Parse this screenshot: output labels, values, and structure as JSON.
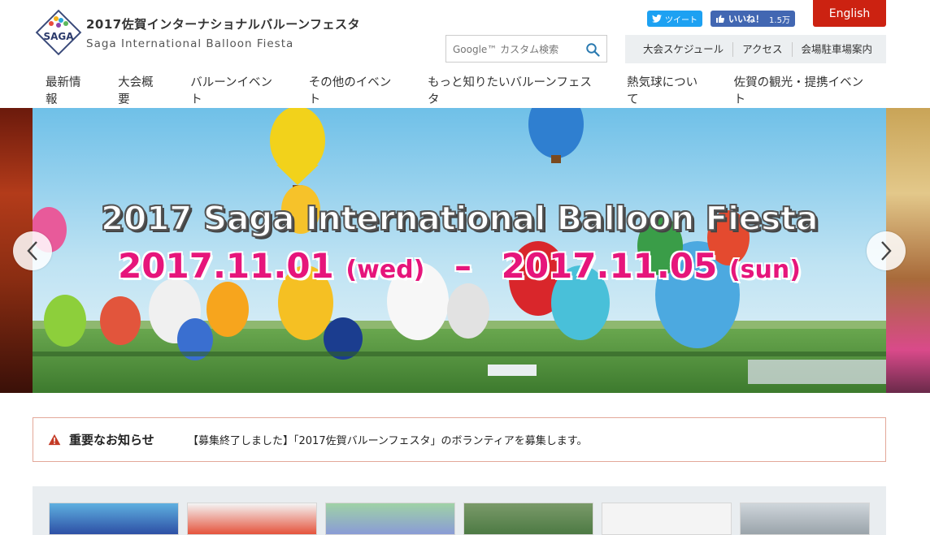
{
  "site": {
    "title": "2017佐賀インターナショナルバルーンフェスタ",
    "subtitle": "Saga International Balloon Fiesta",
    "logo_text": "SAGA"
  },
  "social": {
    "tweet_label": "ツイート",
    "like_label": "いいね！",
    "like_count": "1.5万"
  },
  "language_button": "English",
  "search": {
    "placeholder": "Google™ カスタム検索",
    "icon": "search-icon"
  },
  "quick_links": [
    "大会スケジュール",
    "アクセス",
    "会場駐車場案内"
  ],
  "nav": [
    "最新情報",
    "大会概要",
    "バルーンイベント",
    "その他のイベント",
    "もっと知りたいバルーンフェスタ",
    "熱気球について",
    "佐賀の観光・提携イベント"
  ],
  "hero": {
    "title": "2017 Saga International Balloon Fiesta",
    "start_date": "2017.11.01",
    "start_day": "(wed)",
    "separator": "–",
    "end_date": "2017.11.05",
    "end_day": "(sun)",
    "prev_icon": "chevron-left-icon",
    "next_icon": "chevron-right-icon"
  },
  "notice": {
    "heading": "重要なお知らせ",
    "text": "【募集終了しました】「2017佐賀バルーンフェスタ」のボランティアを募集します。"
  },
  "colors": {
    "english_bg": "#cc2211",
    "twitter": "#1da1f2",
    "facebook": "#4267b2",
    "date_pink": "#e6157b",
    "notice_border": "#e3a899",
    "quick_links_bg": "#eceff1"
  }
}
